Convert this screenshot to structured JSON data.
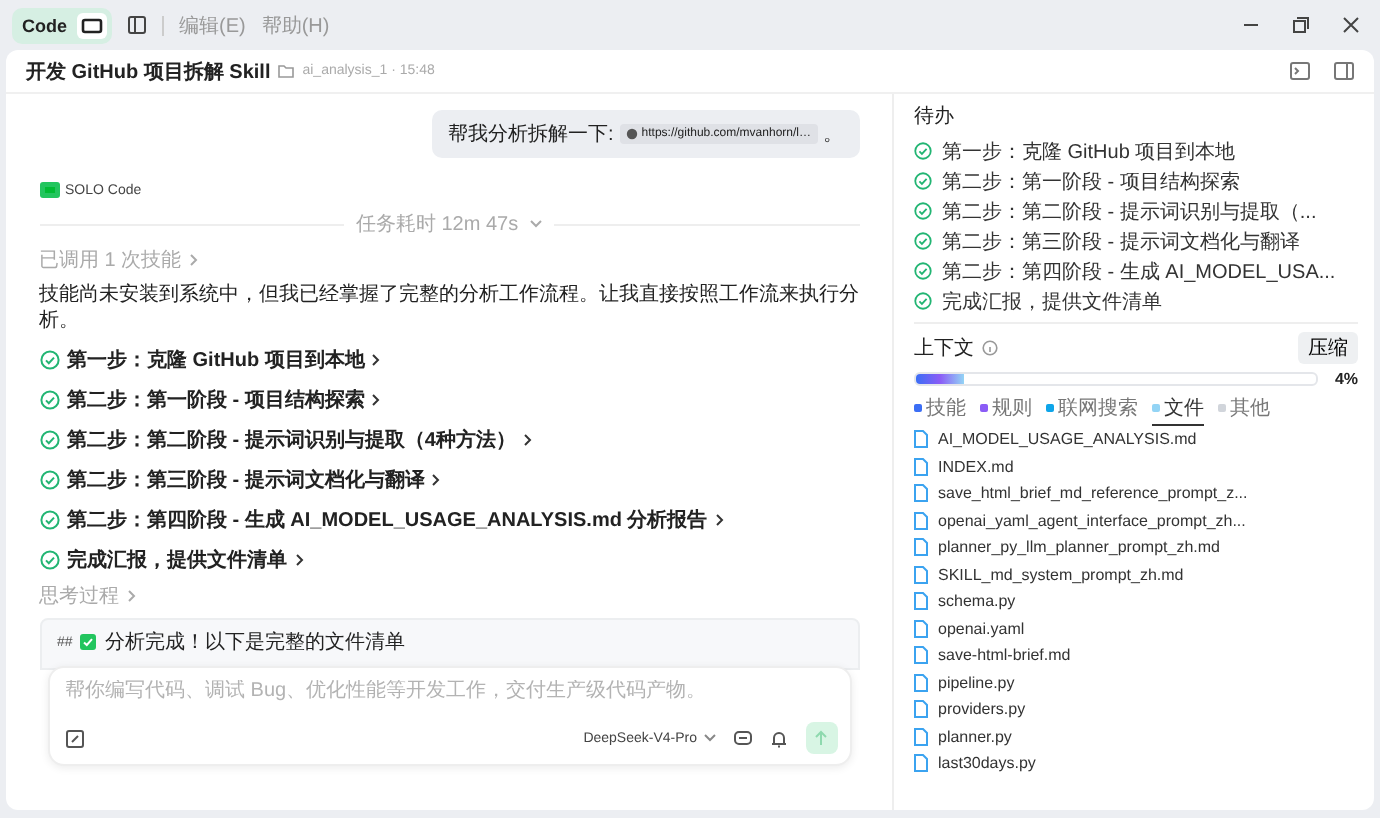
{
  "titlebar": {
    "mode": {
      "label": "Code",
      "selected": true
    },
    "menu": [
      "编辑(E)",
      "帮助(H)"
    ]
  },
  "header": {
    "title": "开发 GitHub 项目拆解 Skill",
    "path": "ai_analysis_1 · 15:48"
  },
  "chat": {
    "user_message": {
      "text": "帮我分析拆解一下:",
      "link": "https://github.com/mvanhorn/l…",
      "suffix": "。"
    },
    "agent": "SOLO Code",
    "duration": "任务耗时 12m 47s",
    "skills": "已调用 1 次技能",
    "intro": "技能尚未安装到系统中，但我已经掌握了完整的分析工作流程。让我直接按照工作流来执行分析。",
    "steps": [
      {
        "label": "第一步：克隆 GitHub 项目到本地",
        "done": true
      },
      {
        "label": "第二步：第一阶段 - 项目结构探索",
        "done": true
      },
      {
        "label": "第二步：第二阶段 - 提示词识别与提取（4种方法）",
        "done": true
      },
      {
        "label": "第二步：第三阶段 - 提示词文档化与翻译",
        "done": true
      },
      {
        "label": "第二步：第四阶段 - 生成 AI_MODEL_USAGE_ANALYSIS.md 分析报告",
        "done": true
      },
      {
        "label": "完成汇报，提供文件清单",
        "done": true
      }
    ],
    "thinking": "思考过程",
    "preview": {
      "prefix": "##",
      "text": "分析完成！以下是完整的文件清单"
    }
  },
  "composer": {
    "placeholder": "帮你编写代码、调试 Bug、优化性能等开发工作，交付生产级代码产物。",
    "model": "DeepSeek-V4-Pro"
  },
  "sidebar": {
    "todo_title": "待办",
    "todos": [
      {
        "label": "第一步：克隆 GitHub 项目到本地",
        "done": true
      },
      {
        "label": "第二步：第一阶段 - 项目结构探索",
        "done": true
      },
      {
        "label": "第二步：第二阶段 - 提示词识别与提取（...",
        "done": true
      },
      {
        "label": "第二步：第三阶段 - 提示词文档化与翻译",
        "done": true
      },
      {
        "label": "第二步：第四阶段 - 生成 AI_MODEL_USA...",
        "done": true
      },
      {
        "label": "完成汇报，提供文件清单",
        "done": true
      }
    ],
    "context": {
      "title": "上下文",
      "compress": "压缩",
      "usage": "4%",
      "level": 0.12,
      "legend": [
        {
          "label": "技能",
          "color": "#3b6ef5",
          "selected": false
        },
        {
          "label": "规则",
          "color": "#8b5cf6",
          "selected": false
        },
        {
          "label": "联网搜索",
          "color": "#0ea5e9",
          "selected": false
        },
        {
          "label": "文件",
          "color": "#93d4f5",
          "selected": true
        },
        {
          "label": "其他",
          "color": "#d1d5db",
          "selected": false
        }
      ]
    },
    "files": [
      "AI_MODEL_USAGE_ANALYSIS.md",
      "INDEX.md",
      "save_html_brief_md_reference_prompt_z...",
      "openai_yaml_agent_interface_prompt_zh...",
      "planner_py_llm_planner_prompt_zh.md",
      "SKILL_md_system_prompt_zh.md",
      "schema.py",
      "openai.yaml",
      "save-html-brief.md",
      "pipeline.py",
      "providers.py",
      "planner.py",
      "last30days.py"
    ]
  }
}
